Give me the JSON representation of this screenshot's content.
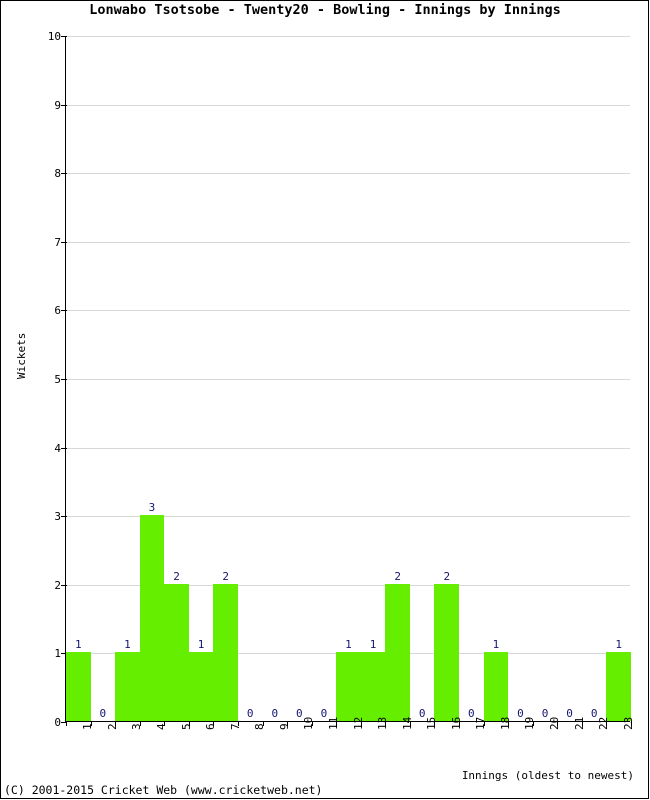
{
  "chart_data": {
    "type": "bar",
    "title": "Lonwabo Tsotsobe - Twenty20 - Bowling - Innings by Innings",
    "xlabel": "Innings (oldest to newest)",
    "ylabel": "Wickets",
    "categories": [
      "1",
      "2",
      "3",
      "4",
      "5",
      "6",
      "7",
      "8",
      "9",
      "10",
      "11",
      "12",
      "13",
      "14",
      "15",
      "16",
      "17",
      "18",
      "19",
      "20",
      "21",
      "22",
      "23"
    ],
    "values": [
      1,
      0,
      1,
      3,
      2,
      1,
      2,
      0,
      0,
      0,
      0,
      1,
      1,
      2,
      0,
      2,
      0,
      1,
      0,
      0,
      0,
      0,
      1
    ],
    "data_labels": [
      "1",
      "0",
      "1",
      "3",
      "2",
      "1",
      "2",
      "0",
      "0",
      "0",
      "0",
      "1",
      "1",
      "2",
      "0",
      "2",
      "0",
      "1",
      "0",
      "0",
      "0",
      "0",
      "1"
    ],
    "ylim": [
      0,
      10
    ],
    "yticks": [
      "0",
      "1",
      "2",
      "3",
      "4",
      "5",
      "6",
      "7",
      "8",
      "9",
      "10"
    ],
    "grid": true,
    "legend": false,
    "bar_color": "#66EE00",
    "label_color": "#151570",
    "grid_color": "#D8D8D8",
    "axis_color": "#000000"
  },
  "footer": {
    "copyright": "(C) 2001-2015 Cricket Web (www.cricketweb.net)"
  }
}
